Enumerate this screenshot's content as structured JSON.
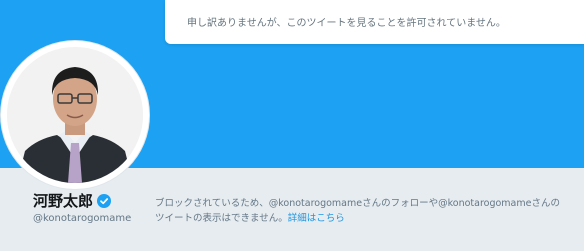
{
  "notice": {
    "text": "申し訳ありませんが、このツイートを見ることを許可されていません。"
  },
  "profile": {
    "name": "河野太郎",
    "handle": "@konotarogomame",
    "verified": true,
    "avatar_icon": "user-avatar-photo"
  },
  "blocked_message": {
    "line1": "ブロックされているため、@konotarogomameさんのフォローや@konotarogomameさんの",
    "line2": "ツイートの表示はできません。",
    "link_text": "詳細はこちら"
  },
  "colors": {
    "banner": "#1da1f2",
    "page_background": "#e6ecf0",
    "link": "#1b95e0",
    "verified_badge": "#1da1f2"
  }
}
